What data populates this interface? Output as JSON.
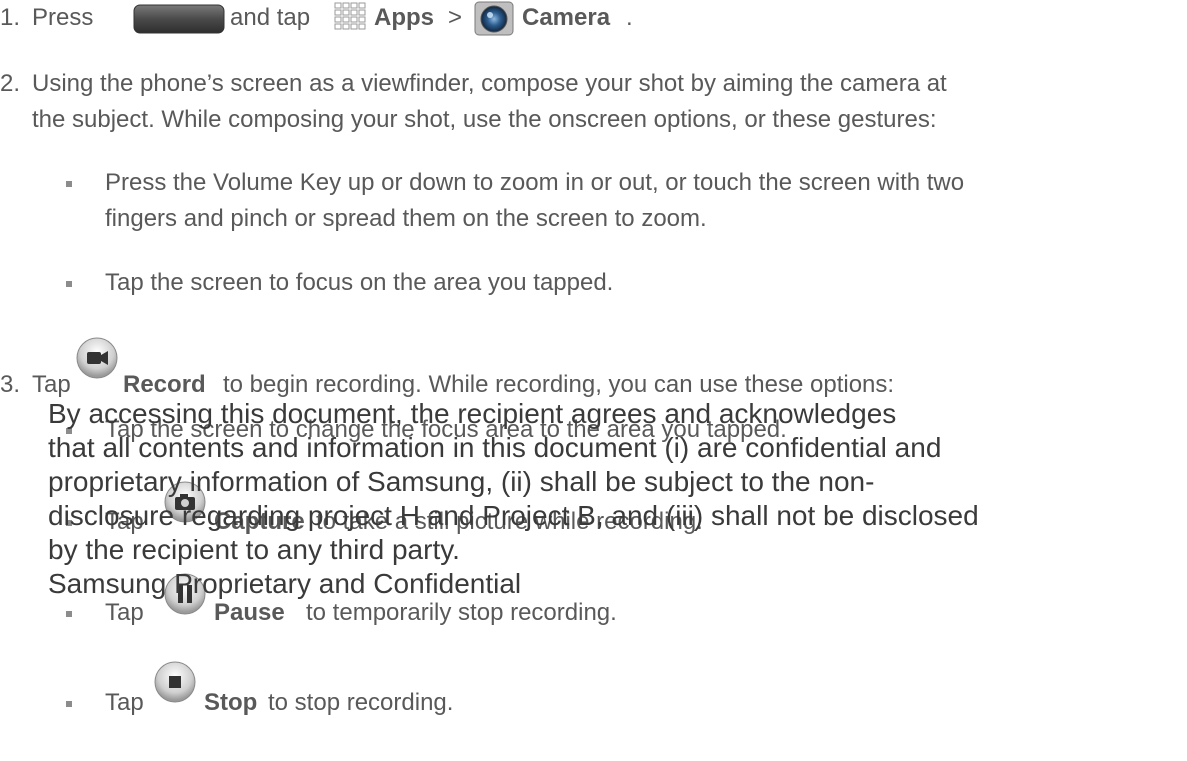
{
  "steps": {
    "s1": {
      "num": "1.",
      "a": "Press",
      "b": "and tap",
      "apps": "Apps",
      "gt": ">",
      "camera": "Camera",
      "end": "."
    },
    "s2": {
      "num": "2.",
      "line1": "Using the phone’s screen as a viewfinder, compose your shot by aiming the camera at",
      "line2": "the subject. While composing your shot, use the onscreen options, or these gestures:",
      "b1_line1": "Press the Volume Key up or down to zoom in or out, or touch the screen with two",
      "b1_line2": "fingers and pinch or spread them on the screen to zoom.",
      "b2": "Tap the screen to focus on the area you tapped."
    },
    "s3": {
      "num": "3.",
      "tap": "Tap",
      "record": "Record",
      "rest": "to begin recording. While recording, you can use these options:",
      "b1": "Tap the screen to change the focus area to the area you tapped.",
      "b2_tap": "Tap",
      "b2_capture": "Capture",
      "b2_rest": "to take a still picture while recording.",
      "b3_tap": "Tap",
      "b3_pause": "Pause",
      "b3_rest": "to temporarily stop recording.",
      "b4_tap": "Tap",
      "b4_stop": "Stop",
      "b4_rest": "to stop recording."
    }
  },
  "watermark": {
    "line1": "By accessing this document, the recipient agrees and acknowledges",
    "line2": "that all contents and information in this document (i) are confidential and",
    "line3": "proprietary information of Samsung, (ii) shall be subject to the non-",
    "line4": "disclosure regarding project H and Project B, and (iii) shall not be disclosed",
    "line5": "by the recipient to any third party.",
    "line6": "Samsung Proprietary and Confidential"
  },
  "icons": {
    "home_key": "home-key-icon",
    "apps": "apps-grid-icon",
    "camera": "camera-app-icon",
    "record": "record-video-icon",
    "capture": "capture-camera-icon",
    "pause": "pause-icon",
    "stop": "stop-icon"
  },
  "colors": {
    "text": "#595959",
    "watermark": "#3a3a3a",
    "bullet": "#8c8c8c"
  }
}
